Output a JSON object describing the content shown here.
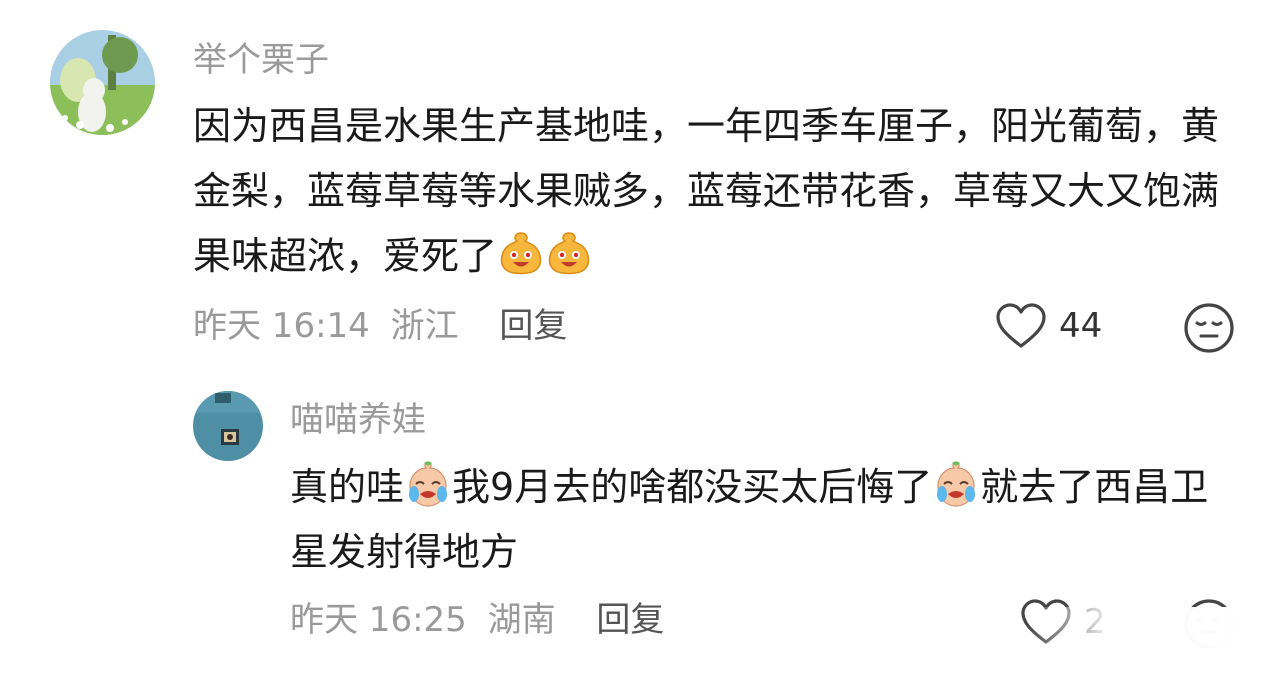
{
  "comments": [
    {
      "username": "举个栗子",
      "content_parts": [
        "因为西昌是水果生产基地哇，一年四季车厘子，阳光葡萄，黄金梨，蓝莓草莓等水果贼多，蓝莓还带花香，草莓又大又饱满果味超浓，爱死了"
      ],
      "emoji_name": "laughing-bag-emoji",
      "date": "昨天 16:14",
      "location": "浙江",
      "reply_label": "回复",
      "like_count": "44",
      "like_icon": "heart-icon",
      "dislike_icon": "meh-face-icon"
    },
    {
      "username": "喵喵养娃",
      "content_a": "真的哇",
      "content_b": "我9月去的啥都没买太后悔了",
      "content_c": "就去了西昌卫星发射得地方",
      "emoji_name": "crying-face-emoji",
      "date": "昨天 16:25",
      "location": "湖南",
      "reply_label": "回复",
      "like_count": "2",
      "like_icon": "heart-icon",
      "dislike_icon": "meh-face-icon"
    }
  ]
}
